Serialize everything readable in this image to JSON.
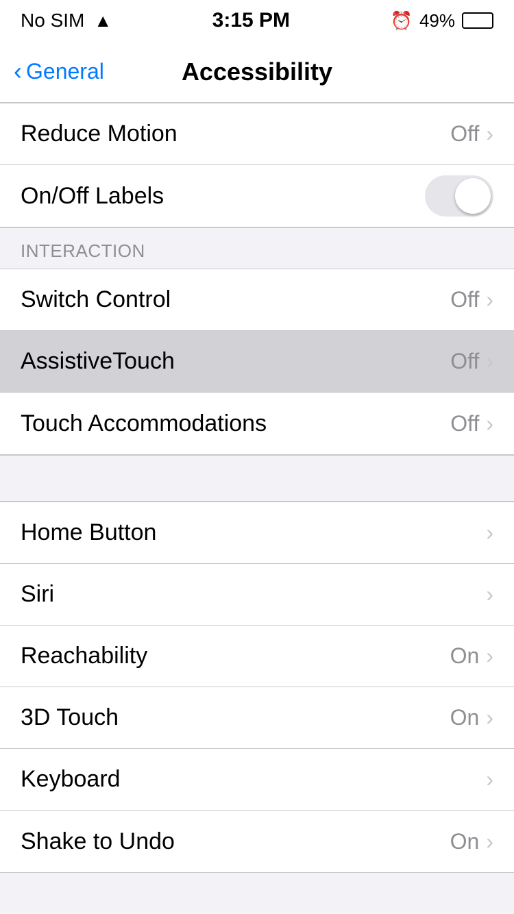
{
  "statusBar": {
    "carrier": "No SIM",
    "time": "3:15 PM",
    "alarmIcon": "⏰",
    "battery": "49%"
  },
  "navBar": {
    "backLabel": "General",
    "title": "Accessibility"
  },
  "sections": {
    "motion": {
      "items": [
        {
          "id": "reduce-motion",
          "label": "Reduce Motion",
          "valueText": "Off",
          "hasChevron": true,
          "hasToggle": false,
          "highlighted": false
        },
        {
          "id": "onoff-labels",
          "label": "On/Off Labels",
          "valueText": "",
          "hasChevron": false,
          "hasToggle": true,
          "highlighted": false
        }
      ]
    },
    "interaction": {
      "header": "INTERACTION",
      "items": [
        {
          "id": "switch-control",
          "label": "Switch Control",
          "valueText": "Off",
          "hasChevron": true,
          "hasToggle": false,
          "highlighted": false
        },
        {
          "id": "assistive-touch",
          "label": "AssistiveTouch",
          "valueText": "Off",
          "hasChevron": true,
          "hasToggle": false,
          "highlighted": true
        },
        {
          "id": "touch-accommodations",
          "label": "Touch Accommodations",
          "valueText": "Off",
          "hasChevron": true,
          "hasToggle": false,
          "highlighted": false
        }
      ]
    },
    "misc": {
      "items": [
        {
          "id": "home-button",
          "label": "Home Button",
          "valueText": "",
          "hasChevron": true,
          "hasToggle": false,
          "highlighted": false
        },
        {
          "id": "siri",
          "label": "Siri",
          "valueText": "",
          "hasChevron": true,
          "hasToggle": false,
          "highlighted": false
        },
        {
          "id": "reachability",
          "label": "Reachability",
          "valueText": "On",
          "hasChevron": true,
          "hasToggle": false,
          "highlighted": false
        },
        {
          "id": "3d-touch",
          "label": "3D Touch",
          "valueText": "On",
          "hasChevron": true,
          "hasToggle": false,
          "highlighted": false
        },
        {
          "id": "keyboard",
          "label": "Keyboard",
          "valueText": "",
          "hasChevron": true,
          "hasToggle": false,
          "highlighted": false
        },
        {
          "id": "shake-to-undo",
          "label": "Shake to Undo",
          "valueText": "On",
          "hasChevron": true,
          "hasToggle": false,
          "highlighted": false
        }
      ]
    }
  }
}
